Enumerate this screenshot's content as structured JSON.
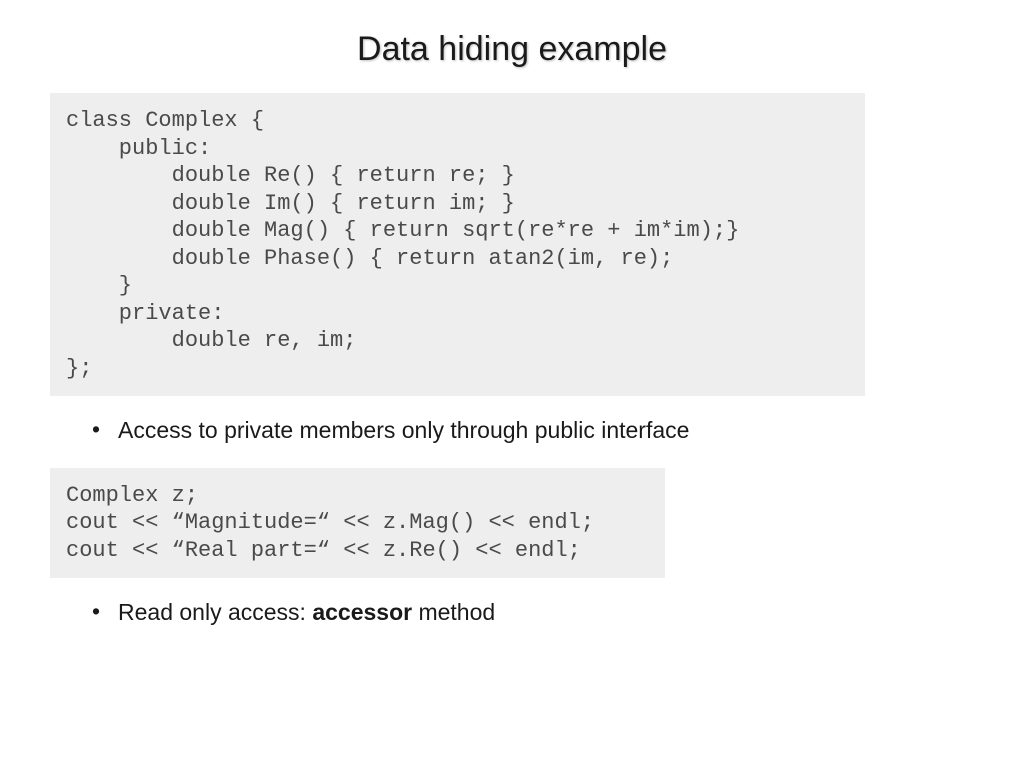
{
  "title": "Data hiding example",
  "code1": "class Complex {\n    public:\n        double Re() { return re; }\n        double Im() { return im; }\n        double Mag() { return sqrt(re*re + im*im);}\n        double Phase() { return atan2(im, re);\n    }\n    private:\n        double re, im;\n};",
  "bullet1": "Access to private members only through public interface",
  "code2": "Complex z;\ncout << “Magnitude=“ << z.Mag() << endl;\ncout << “Real part=“ << z.Re() << endl;",
  "bullet2_prefix": "Read only access: ",
  "bullet2_bold": "accessor",
  "bullet2_suffix": " method",
  "dot": "•"
}
